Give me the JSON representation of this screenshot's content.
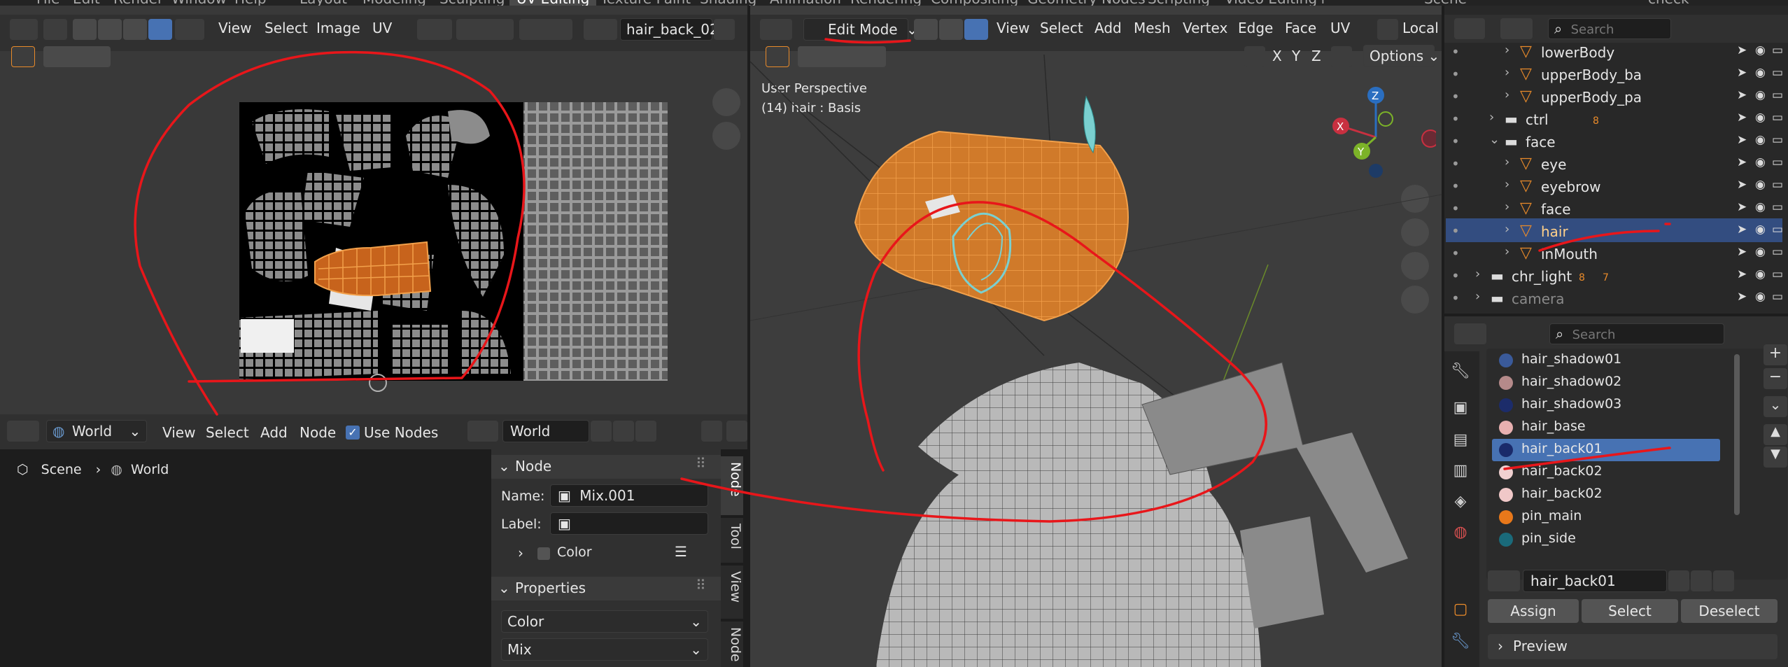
{
  "top_menu": {
    "items": [
      "File",
      "Edit",
      "Render",
      "Window",
      "Help"
    ],
    "workspaces": [
      "Layout",
      "Modeling",
      "Sculpting",
      "UV Editing",
      "Texture Paint",
      "Shading",
      "Animation",
      "Rendering",
      "Compositing",
      "Geometry Nodes",
      "Scripting",
      "Video Editing"
    ],
    "active_workspace": "UV Editing",
    "add_tab": "+",
    "scene_label": "Scene",
    "check_label": "check"
  },
  "uv_editor": {
    "menus": [
      "View",
      "Select",
      "Image",
      "UV"
    ],
    "image_name": "hair_back_02"
  },
  "node_editor": {
    "editor_type": "World",
    "menus": [
      "View",
      "Select",
      "Add",
      "Node"
    ],
    "use_nodes_label": "Use Nodes",
    "world_name": "World",
    "breadcrumb": [
      "Scene",
      "World"
    ],
    "sidebar": {
      "node_section": "Node",
      "name_label": "Name:",
      "name_value": "Mix.001",
      "label_label": "Label:",
      "label_value": "",
      "color_section": "Color",
      "properties_section": "Properties",
      "prop_select_1": "Color",
      "prop_select_2": "Mix",
      "tabs": [
        "Node",
        "Tool",
        "View",
        "Node Pre"
      ]
    }
  },
  "viewport": {
    "mode": "Edit Mode",
    "menus": [
      "View",
      "Select",
      "Add",
      "Mesh",
      "Vertex",
      "Edge",
      "Face",
      "UV"
    ],
    "orientation": "Local",
    "options_label": "Options",
    "axes": [
      "X",
      "Y",
      "Z"
    ],
    "overlay_title": "User Perspective",
    "overlay_object": "(14) hair : Basis",
    "gizmo": {
      "x": "X",
      "y": "Y",
      "z": "Z"
    }
  },
  "outliner": {
    "search_placeholder": "Search",
    "rows": [
      {
        "name": "lowerBody",
        "type": "mesh"
      },
      {
        "name": "upperBody_ba",
        "type": "mesh"
      },
      {
        "name": "upperBody_pa",
        "type": "mesh"
      },
      {
        "name": "ctrl",
        "type": "collection",
        "badge": "8"
      },
      {
        "name": "face",
        "type": "collection"
      },
      {
        "name": "eye",
        "type": "mesh"
      },
      {
        "name": "eyebrow",
        "type": "mesh"
      },
      {
        "name": "face",
        "type": "mesh"
      },
      {
        "name": "hair",
        "type": "mesh",
        "selected": true
      },
      {
        "name": "inMouth",
        "type": "mesh"
      },
      {
        "name": "chr_light",
        "type": "collection",
        "badge": "8",
        "badge2": "7"
      },
      {
        "name": "camera",
        "type": "collection"
      }
    ]
  },
  "properties": {
    "search_placeholder": "Search",
    "materials": [
      {
        "name": "hair_shadow01",
        "color": "#3a5a9a"
      },
      {
        "name": "hair_shadow02",
        "color": "#b58a8a"
      },
      {
        "name": "hair_shadow03",
        "color": "#1c2c6a"
      },
      {
        "name": "hair_base",
        "color": "#e8b0b0"
      },
      {
        "name": "hair_back01",
        "color": "#1a2a6a",
        "selected": true
      },
      {
        "name": "hair_back02",
        "color": "#f0d0d0"
      },
      {
        "name": "hair_back02",
        "color": "#f0c8c8"
      },
      {
        "name": "pin_main",
        "color": "#e8781a"
      },
      {
        "name": "pin_side",
        "color": "#1a6a7a"
      }
    ],
    "active_material": "hair_back01",
    "assign_label": "Assign",
    "select_label": "Select",
    "deselect_label": "Deselect",
    "preview_label": "Preview"
  },
  "colors": {
    "accent_blue": "#4772b3",
    "orange": "#e88a2a",
    "annotation_red": "#e8161a"
  }
}
